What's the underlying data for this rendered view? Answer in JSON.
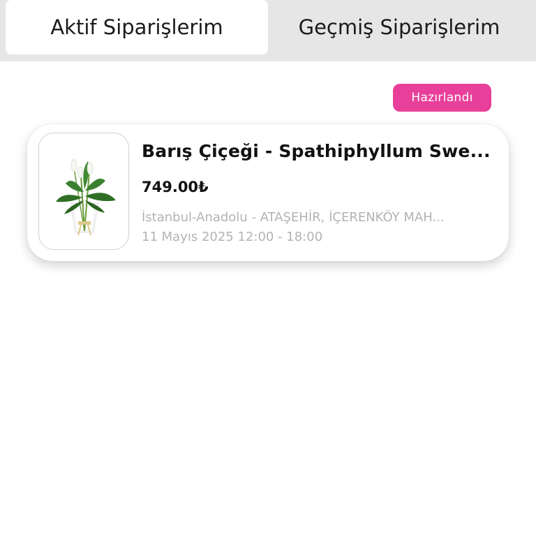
{
  "tabs": {
    "active_label": "Aktif Siparişlerim",
    "past_label": "Geçmiş Siparişlerim"
  },
  "order": {
    "status": "Hazırlandı",
    "status_color": "#e8409a",
    "product_name": "Barış Çiçeği - Spathiphyllum Swe...",
    "price": "749.00₺",
    "address": "İstanbul-Anadolu - ATAŞEHİR, İÇERENKÖY MAH...",
    "delivery": "11 Mayıs 2025 12:00 - 18:00",
    "image_icon": "peace-lily-plant-icon"
  }
}
